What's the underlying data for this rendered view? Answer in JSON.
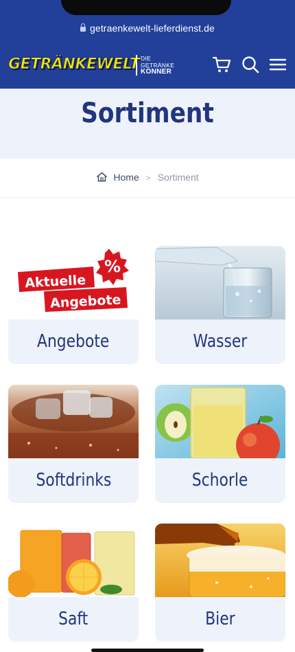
{
  "browser": {
    "url": "getraenkewelt-lieferdienst.de"
  },
  "header": {
    "logo_text": "GETRÄNKEWELT",
    "tagline_line1": "DIE",
    "tagline_line2": "GETRÄNKE",
    "tagline_line3": "KÖNNER",
    "brand_color": "#22409a",
    "logo_color": "#f3e600",
    "icons": [
      "cart-icon",
      "search-icon",
      "menu-icon"
    ]
  },
  "page": {
    "title": "Sortiment",
    "accent_color": "#22357d"
  },
  "breadcrumb": {
    "home": "Home",
    "separator": ">",
    "current": "Sortiment"
  },
  "categories": [
    {
      "label": "Angebote",
      "badge_line1": "Aktuelle",
      "badge_line2": "Angebote",
      "badge_symbol": "%"
    },
    {
      "label": "Wasser"
    },
    {
      "label": "Softdrinks"
    },
    {
      "label": "Schorle"
    },
    {
      "label": "Saft"
    },
    {
      "label": "Bier"
    }
  ]
}
